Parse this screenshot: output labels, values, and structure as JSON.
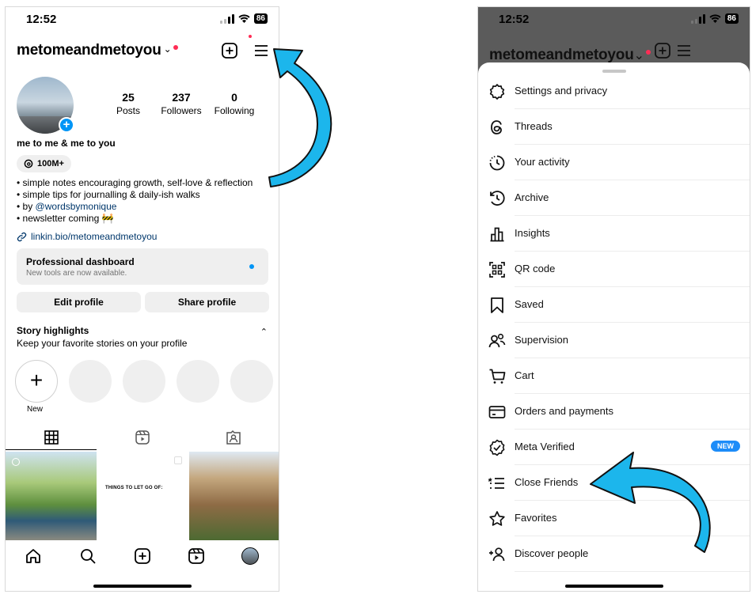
{
  "left": {
    "status": {
      "time": "12:52",
      "battery": "86"
    },
    "header": {
      "username": "metomeandmetoyou",
      "chevron": "⌄"
    },
    "stats": [
      {
        "value": "25",
        "label": "Posts"
      },
      {
        "value": "237",
        "label": "Followers"
      },
      {
        "value": "0",
        "label": "Following"
      }
    ],
    "bio_name": "me to me & me to you",
    "threads_count": "100M+",
    "bio_lines": [
      "• simple notes encouraging growth, self-love & reflection",
      "• simple tips for journalling & daily-ish walks",
      "• by ",
      "• newsletter coming 🚧"
    ],
    "bio_mention": "@wordsbymonique",
    "link": "linkin.bio/metomeandmetoyou",
    "dashboard": {
      "title": "Professional dashboard",
      "subtitle": "New tools are now available."
    },
    "buttons": {
      "edit": "Edit profile",
      "share": "Share profile"
    },
    "highlights": {
      "title": "Story highlights",
      "subtitle": "Keep your favorite stories on your profile",
      "new_label": "New",
      "caret": "⌃"
    },
    "grid_text": "THINGS TO LET GO OF:",
    "icons": [
      "new-post-icon",
      "menu-icon",
      "grid-icon",
      "reels-icon",
      "tagged-icon",
      "home-icon",
      "search-icon",
      "create-icon",
      "reels-nav-icon",
      "profile-avatar"
    ]
  },
  "right": {
    "status": {
      "time": "12:52",
      "battery": "86"
    },
    "header": {
      "username": "metomeandmetoyou",
      "chevron": "⌄"
    },
    "menu": [
      {
        "label": "Settings and privacy",
        "icon": "settings-icon"
      },
      {
        "label": "Threads",
        "icon": "threads-icon"
      },
      {
        "label": "Your activity",
        "icon": "activity-icon"
      },
      {
        "label": "Archive",
        "icon": "archive-icon"
      },
      {
        "label": "Insights",
        "icon": "insights-icon"
      },
      {
        "label": "QR code",
        "icon": "qr-code-icon"
      },
      {
        "label": "Saved",
        "icon": "saved-icon"
      },
      {
        "label": "Supervision",
        "icon": "supervision-icon"
      },
      {
        "label": "Cart",
        "icon": "cart-icon"
      },
      {
        "label": "Orders and payments",
        "icon": "orders-icon"
      },
      {
        "label": "Meta Verified",
        "icon": "verified-icon",
        "badge": "NEW"
      },
      {
        "label": "Close Friends",
        "icon": "close-friends-icon"
      },
      {
        "label": "Favorites",
        "icon": "favorites-icon"
      },
      {
        "label": "Discover people",
        "icon": "discover-people-icon"
      }
    ]
  },
  "colors": {
    "accent_blue": "#0095f6",
    "annotation_arrow": "#1cb6ec",
    "notification_red": "#ff2d55"
  }
}
